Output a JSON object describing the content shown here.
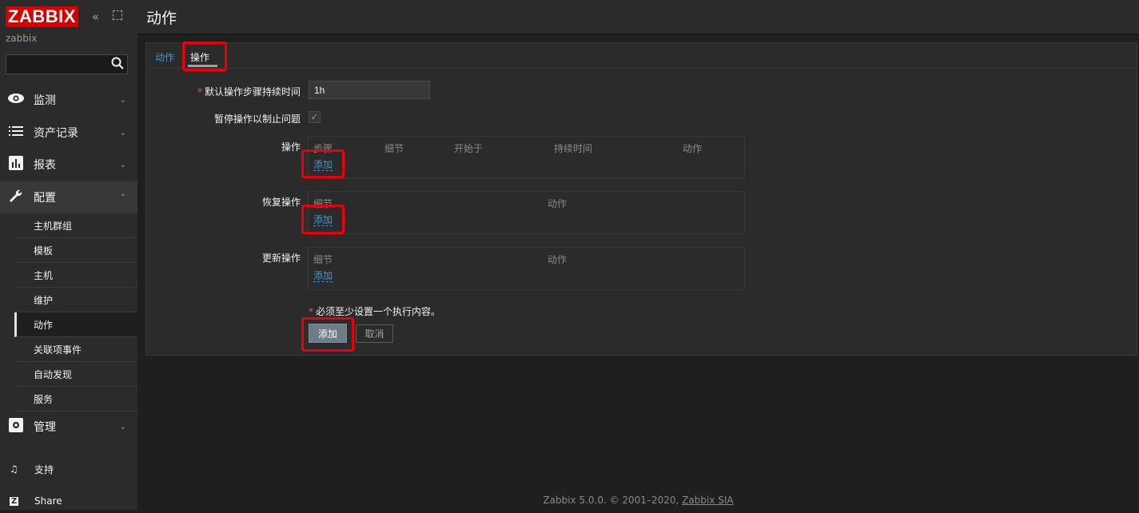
{
  "sidebar": {
    "logo": "ZABBIX",
    "collapse_icon": "double-chevron-left-icon",
    "server_name": "zabbix",
    "search": {
      "value": "",
      "placeholder": ""
    },
    "menu": [
      {
        "label": "监测",
        "icon": "eye-icon",
        "expanded": false
      },
      {
        "label": "资产记录",
        "icon": "list-icon",
        "expanded": false
      },
      {
        "label": "报表",
        "icon": "bar-chart-icon",
        "expanded": false
      },
      {
        "label": "配置",
        "icon": "wrench-icon",
        "expanded": true
      },
      {
        "label": "管理",
        "icon": "gear-icon",
        "expanded": false
      }
    ],
    "submenu": [
      "主机群组",
      "模板",
      "主机",
      "维护",
      "动作",
      "关联项事件",
      "自动发现",
      "服务"
    ],
    "submenu_selected": "动作",
    "bottom": [
      {
        "label": "支持",
        "icon": "headset-icon"
      },
      {
        "label": "Share",
        "icon": "z-icon"
      }
    ]
  },
  "header": {
    "title": "动作"
  },
  "tabs": [
    {
      "label": "动作",
      "active": false
    },
    {
      "label": "操作",
      "active": true
    }
  ],
  "form": {
    "default_duration_label": "默认操作步骤持续时间",
    "default_duration_value": "1h",
    "pause_label": "暂停操作以制止问题",
    "pause_checked": true,
    "operations": {
      "label": "操作",
      "columns": [
        "步骤",
        "细节",
        "开始于",
        "持续时间",
        "动作"
      ],
      "add_link": "添加"
    },
    "recovery": {
      "label": "恢复操作",
      "columns": [
        "细节",
        "动作"
      ],
      "add_link": "添加"
    },
    "update": {
      "label": "更新操作",
      "columns": [
        "细节",
        "动作"
      ],
      "add_link": "添加"
    },
    "hint": "必须至少设置一个执行内容。",
    "add_button": "添加",
    "cancel_button": "取消"
  },
  "footer": {
    "text": "Zabbix 5.0.0. © 2001–2020,",
    "link": "Zabbix SIA"
  },
  "colors": {
    "accent_link": "#4796c4",
    "logo_red": "#d40000",
    "highlight_red": "#e8000b",
    "required": "#e45959"
  }
}
